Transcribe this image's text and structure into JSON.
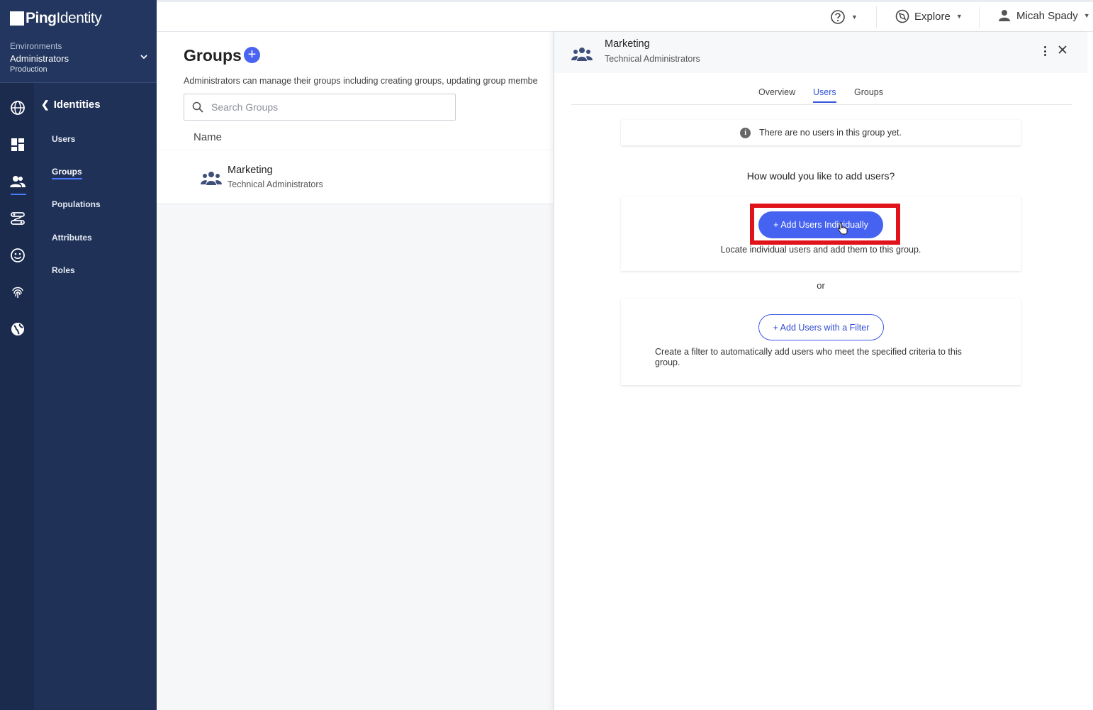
{
  "brand": {
    "ping": "Ping",
    "identity": "Identity"
  },
  "environment": {
    "label": "Environments",
    "name": "Administrators",
    "type": "Production"
  },
  "rail_icons": [
    "globe-icon",
    "dashboard-icon",
    "identities-icon",
    "connections-icon",
    "experiences-icon",
    "fingerprint-icon",
    "world-icon"
  ],
  "subnav": {
    "back_label": "Identities",
    "items": [
      {
        "label": "Users"
      },
      {
        "label": "Groups"
      },
      {
        "label": "Populations"
      },
      {
        "label": "Attributes"
      },
      {
        "label": "Roles"
      }
    ],
    "active": "Groups"
  },
  "topbar": {
    "explore_label": "Explore",
    "user_name": "Micah Spady"
  },
  "main": {
    "title": "Groups",
    "description": "Administrators can manage their groups including creating groups, updating group membe",
    "search_placeholder": "Search Groups",
    "column_name": "Name",
    "groups": [
      {
        "name": "Marketing",
        "subtitle": "Technical Administrators"
      }
    ]
  },
  "panel": {
    "title": "Marketing",
    "subtitle": "Technical Administrators",
    "tabs": [
      {
        "label": "Overview"
      },
      {
        "label": "Users"
      },
      {
        "label": "Groups"
      }
    ],
    "active_tab": "Users",
    "notice": "There are no users in this group yet.",
    "question": "How would you like to add users?",
    "add_individually_label": "+ Add Users Individually",
    "add_individually_desc": "Locate individual users and add them to this group.",
    "or_label": "or",
    "add_filter_label": "+ Add Users with a Filter",
    "add_filter_desc": "Create a filter to automatically add users who meet the specified criteria to this group."
  },
  "colors": {
    "sidebar": "#1f3157",
    "accent": "#4563f0",
    "highlight": "#e1131a"
  }
}
